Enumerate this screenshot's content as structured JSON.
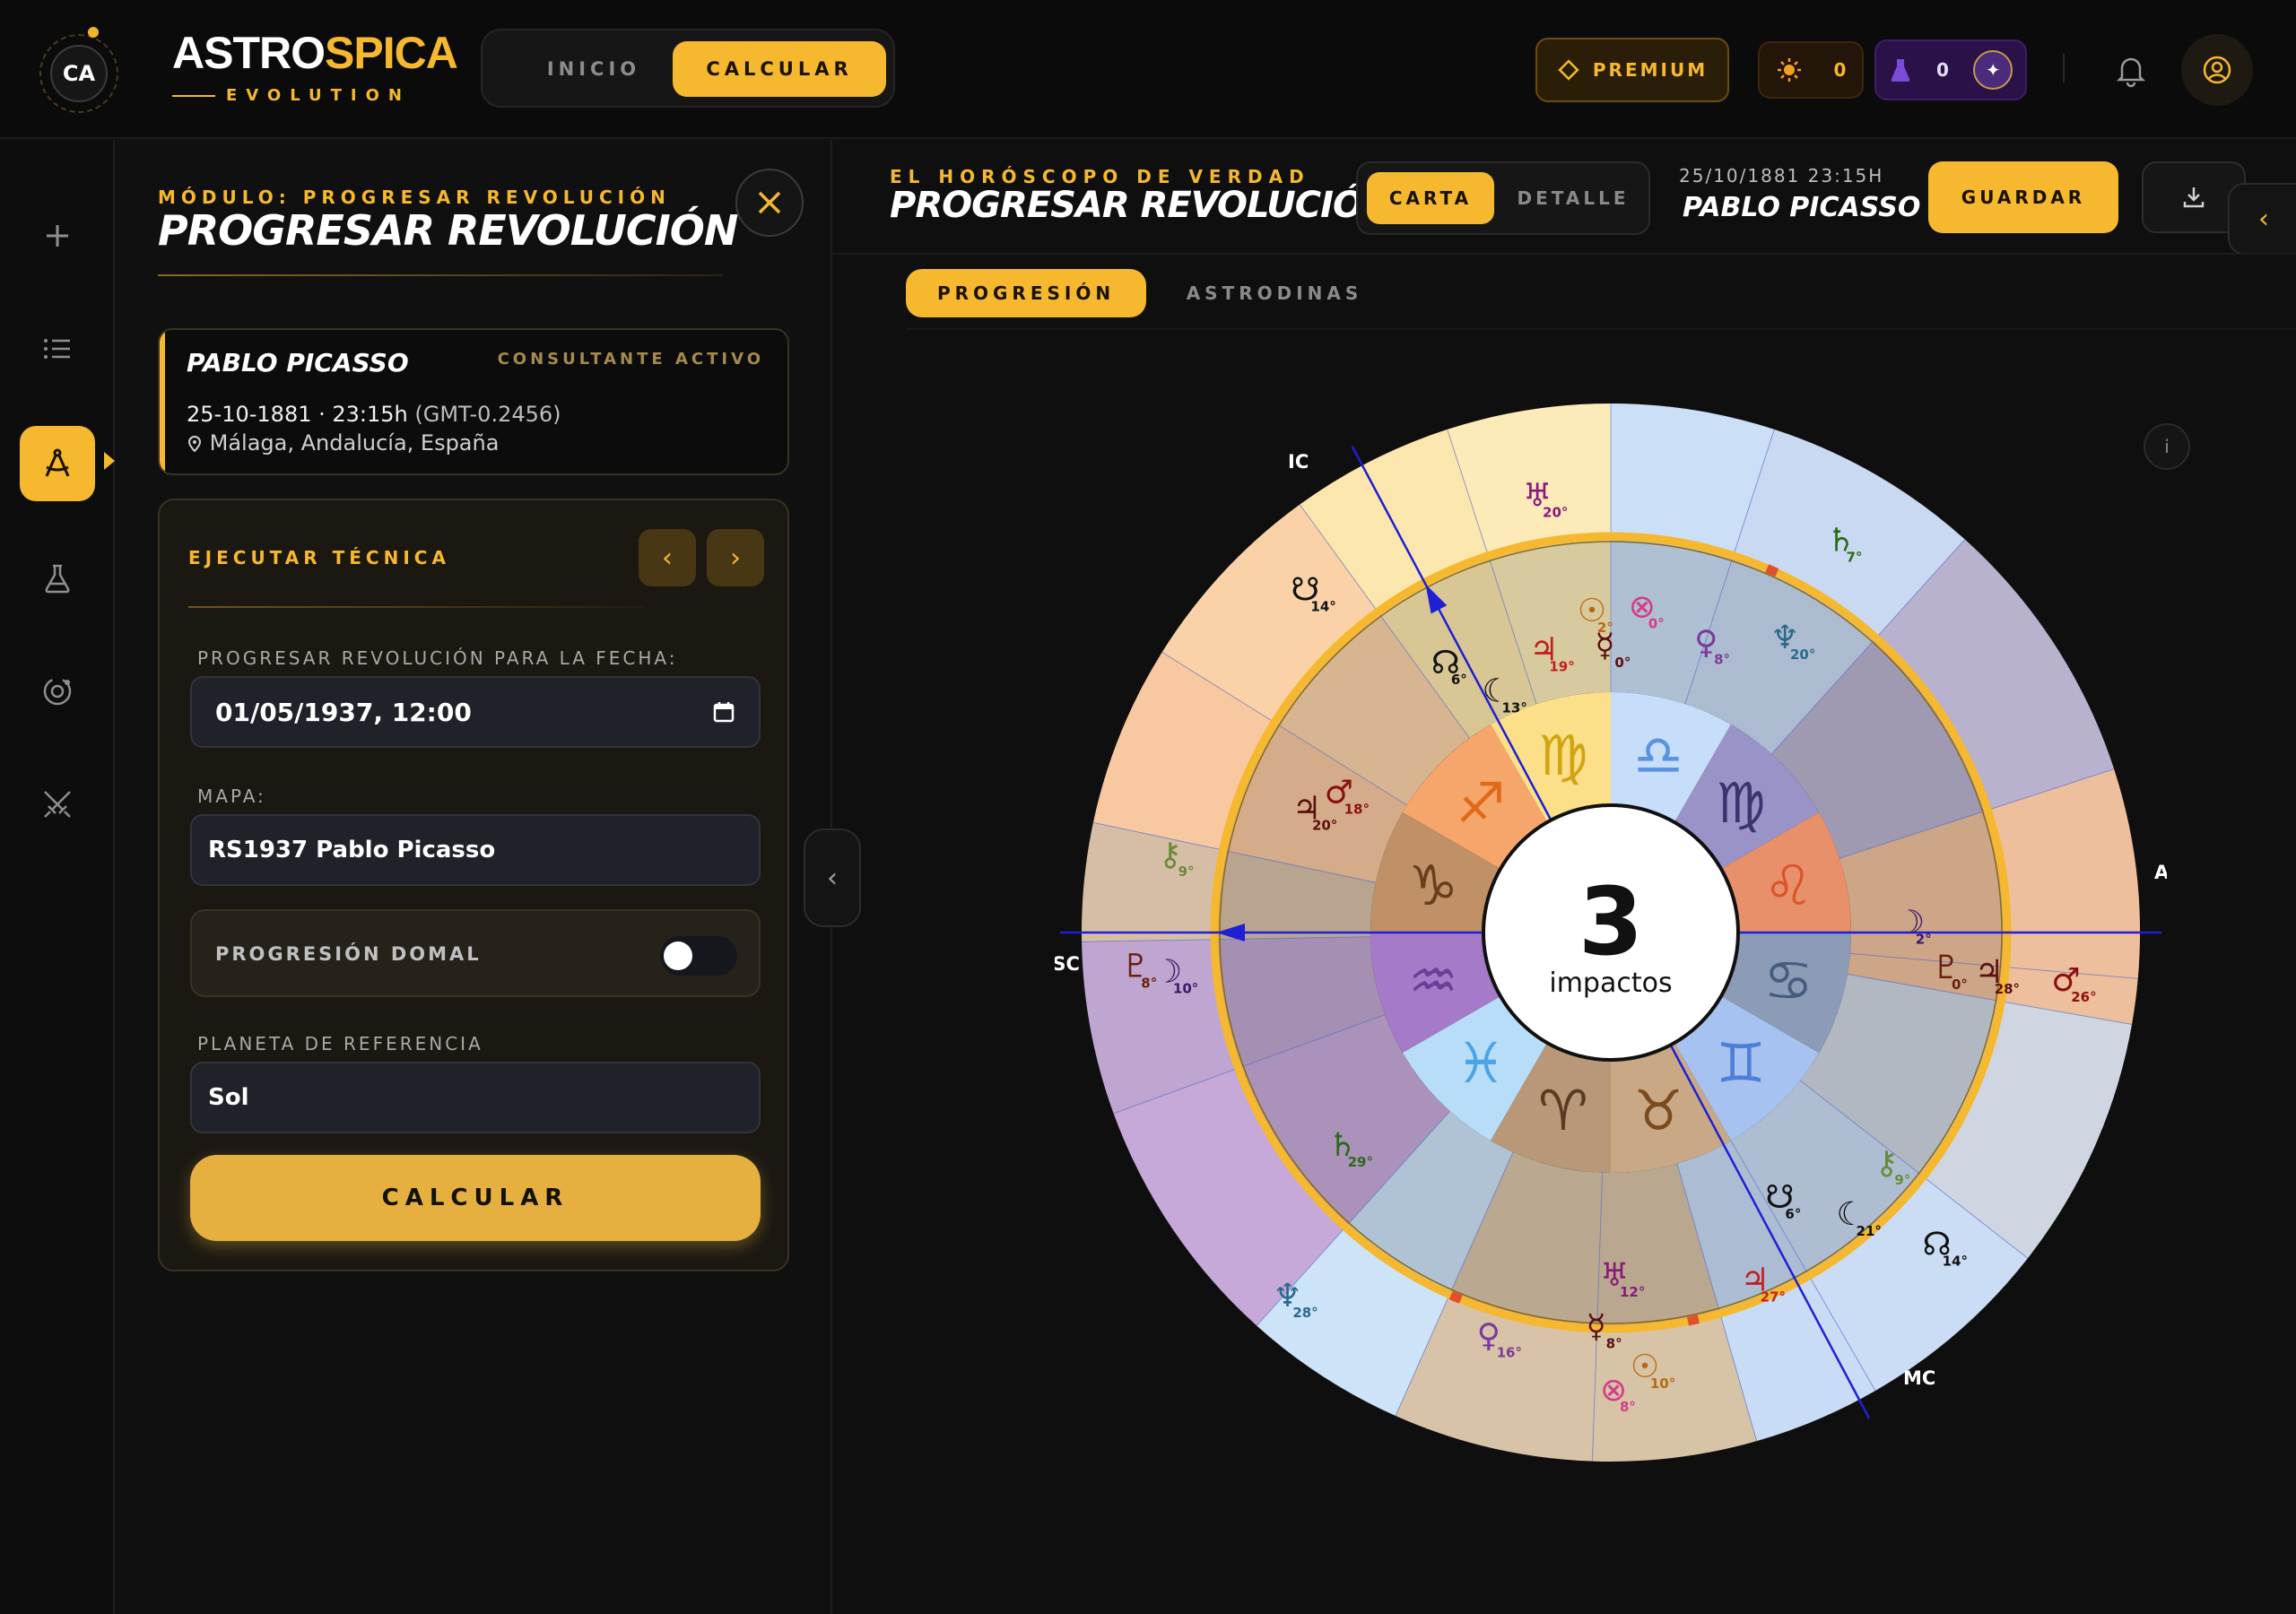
{
  "header": {
    "logo_initials": "CA",
    "brand_white": "ASTRO",
    "brand_gold": "SPICA",
    "brand_sub": "EVOLUTION",
    "nav": [
      {
        "label": "INICIO"
      },
      {
        "label": "CALCULAR"
      }
    ],
    "premium_label": "PREMIUM",
    "sun_count": "0",
    "potion_count": "0"
  },
  "left_panel": {
    "kicker": "MÓDULO: PROGRESAR REVOLUCIÓN",
    "title": "PROGRESAR REVOLUCIÓN",
    "client": {
      "name": "PABLO PICASSO",
      "badge": "CONSULTANTE ACTIVO",
      "datetime": "25-10-1881 · 23:15h",
      "gmt": "(GMT-0.2456)",
      "place": "Málaga, Andalucía, España"
    },
    "form": {
      "kicker": "EJECUTAR TÉCNICA",
      "date_label": "PROGRESAR REVOLUCIÓN PARA LA FECHA:",
      "date_value": "01/05/1937, 12:00",
      "map_label": "MAPA:",
      "map_value": "RS1937 Pablo Picasso",
      "domal_label": "PROGRESIÓN DOMAL",
      "domal_on": false,
      "ref_label": "PLANETA DE REFERENCIA",
      "ref_value": "Sol",
      "submit_label": "CALCULAR"
    }
  },
  "right_panel": {
    "kicker": "EL HORÓSCOPO DE VERDAD",
    "title": "PROGRESAR REVOLUCIÓN",
    "view_tabs": [
      {
        "label": "CARTA"
      },
      {
        "label": "DETALLE"
      }
    ],
    "datetime": "25/10/1881 23:15H",
    "name": "PABLO PICASSO",
    "save_label": "GUARDAR",
    "tabs": [
      {
        "label": "PROGRESIÓN"
      },
      {
        "label": "ASTRODINAS"
      }
    ],
    "center_number": "3",
    "center_label": "impactos",
    "angle_labels": {
      "asc": "ASC",
      "dsc": "DSC",
      "ic": "IC",
      "mc": "MC"
    },
    "colors": {
      "accent": "#f5b82e",
      "axis": "#1f1fd6"
    },
    "zodiac": [
      {
        "glyph": "♎",
        "color": "#5a94e0"
      },
      {
        "glyph": "♍",
        "color": "#3c3470"
      },
      {
        "glyph": "♌",
        "color": "#d8552b"
      },
      {
        "glyph": "♋",
        "color": "#455c7f"
      },
      {
        "glyph": "♊",
        "color": "#4d7ed8"
      },
      {
        "glyph": "♉",
        "color": "#7a4b1d"
      },
      {
        "glyph": "♈",
        "color": "#5a3b22"
      },
      {
        "glyph": "♓",
        "color": "#4aa4e8"
      },
      {
        "glyph": "♒",
        "color": "#6a3f9a"
      },
      {
        "glyph": "♑",
        "color": "#6a3d1c"
      },
      {
        "glyph": "♐",
        "color": "#e06a18"
      },
      {
        "glyph": "♍",
        "color": "#d2a413"
      }
    ],
    "inner_planets": [
      {
        "glyph": "☉",
        "deg": "2°",
        "color": "#b86a10"
      },
      {
        "glyph": "⊗",
        "deg": "0°",
        "color": "#d43c8a"
      },
      {
        "glyph": "☿",
        "deg": "0°",
        "color": "#5a1010"
      },
      {
        "glyph": "♀",
        "deg": "8°",
        "color": "#7a3b9a"
      },
      {
        "glyph": "♆",
        "deg": "20°",
        "color": "#2a6a8a"
      },
      {
        "glyph": "♃",
        "deg": "19°",
        "color": "#c02020"
      },
      {
        "glyph": "☊",
        "deg": "6°",
        "color": "#111111"
      },
      {
        "glyph": "☾",
        "deg": "13°",
        "color": "#111111"
      },
      {
        "glyph": "♂",
        "deg": "18°",
        "color": "#8a1010"
      },
      {
        "glyph": "♃",
        "deg": "20°",
        "color": "#5a1010"
      },
      {
        "glyph": "⚷",
        "deg": "9°",
        "color": "#6a8a3a"
      },
      {
        "glyph": "♇",
        "deg": "8°",
        "color": "#6a2010"
      },
      {
        "glyph": "☽",
        "deg": "10°",
        "color": "#3a1a6a"
      },
      {
        "glyph": "♄",
        "deg": "29°",
        "color": "#2a6a1a"
      },
      {
        "glyph": "♆",
        "deg": "28°",
        "color": "#2a6a8a"
      },
      {
        "glyph": "♀",
        "deg": "16°",
        "color": "#7a3b9a"
      },
      {
        "glyph": "♅",
        "deg": "12°",
        "color": "#8a1a7a"
      },
      {
        "glyph": "☿",
        "deg": "8°",
        "color": "#5a1010"
      },
      {
        "glyph": "⊗",
        "deg": "8°",
        "color": "#d43c8a"
      },
      {
        "glyph": "☉",
        "deg": "10°",
        "color": "#b86a10"
      },
      {
        "glyph": "♃",
        "deg": "27°",
        "color": "#c02020"
      },
      {
        "glyph": "☋",
        "deg": "6°",
        "color": "#111111"
      },
      {
        "glyph": "☾",
        "deg": "21°",
        "color": "#111111"
      },
      {
        "glyph": "☊",
        "deg": "14°",
        "color": "#111111"
      },
      {
        "glyph": "⚷",
        "deg": "9°",
        "color": "#6a8a3a"
      },
      {
        "glyph": "☽",
        "deg": "2°",
        "color": "#3a1a6a"
      },
      {
        "glyph": "♇",
        "deg": "0°",
        "color": "#6a2010"
      },
      {
        "glyph": "♃",
        "deg": "28°",
        "color": "#5a1010"
      },
      {
        "glyph": "♂",
        "deg": "26°",
        "color": "#8a1010"
      },
      {
        "glyph": "♄",
        "deg": "7°",
        "color": "#2a6a1a"
      },
      {
        "glyph": "♅",
        "deg": "20°",
        "color": "#8a1a7a"
      },
      {
        "glyph": "☋",
        "deg": "14°",
        "color": "#111111"
      }
    ]
  }
}
